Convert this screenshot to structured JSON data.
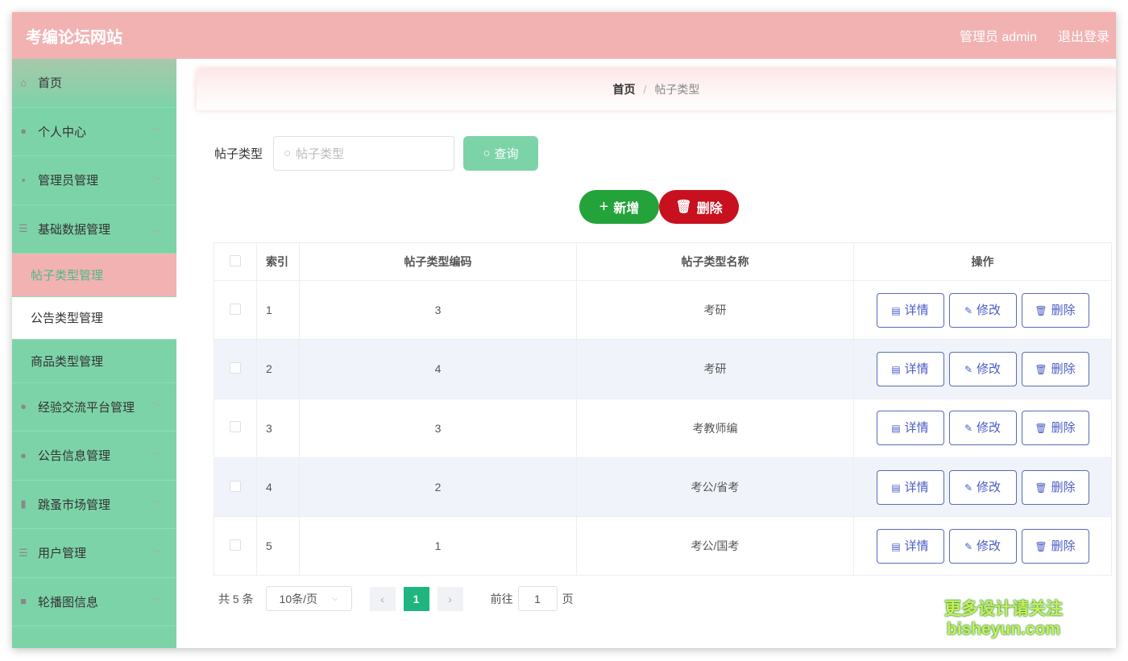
{
  "header": {
    "title": "考编论坛网站",
    "user": "管理员 admin",
    "logout": "退出登录"
  },
  "sidebar": {
    "items": [
      {
        "label": "首页",
        "icon": "⌂"
      },
      {
        "label": "个人中心",
        "icon": "●"
      },
      {
        "label": "管理员管理",
        "icon": "▪"
      },
      {
        "label": "基础数据管理",
        "icon": "☰"
      }
    ],
    "sub": [
      "帖子类型管理",
      "公告类型管理",
      "商品类型管理"
    ],
    "items2": [
      {
        "label": "经验交流平台管理",
        "icon": "●"
      },
      {
        "label": "公告信息管理",
        "icon": "●"
      },
      {
        "label": "跳蚤市场管理",
        "icon": "▮"
      },
      {
        "label": "用户管理",
        "icon": "☰"
      },
      {
        "label": "轮播图信息",
        "icon": "■"
      }
    ]
  },
  "breadcrumb": {
    "home": "首页",
    "sep": "/",
    "current": "帖子类型"
  },
  "search": {
    "label": "帖子类型",
    "placeholder": "帖子类型",
    "button": "查询"
  },
  "actions": {
    "add": "新增",
    "delete": "删除"
  },
  "table": {
    "headers": [
      "索引",
      "帖子类型编码",
      "帖子类型名称",
      "操作"
    ],
    "rows": [
      [
        "1",
        "3",
        "考研"
      ],
      [
        "2",
        "4",
        "考研"
      ],
      [
        "3",
        "3",
        "考教师编"
      ],
      [
        "4",
        "2",
        "考公/省考"
      ],
      [
        "5",
        "1",
        "考公/国考"
      ]
    ],
    "ops": [
      "详情",
      "修改",
      "删除"
    ]
  },
  "pagination": {
    "total": "共 5 条",
    "size": "10条/页",
    "page": "1",
    "goto": "前往",
    "goto_value": "1",
    "page_unit": "页"
  },
  "watermark": {
    "line1": "更多设计请关注",
    "line2": "bisheyun.com"
  }
}
